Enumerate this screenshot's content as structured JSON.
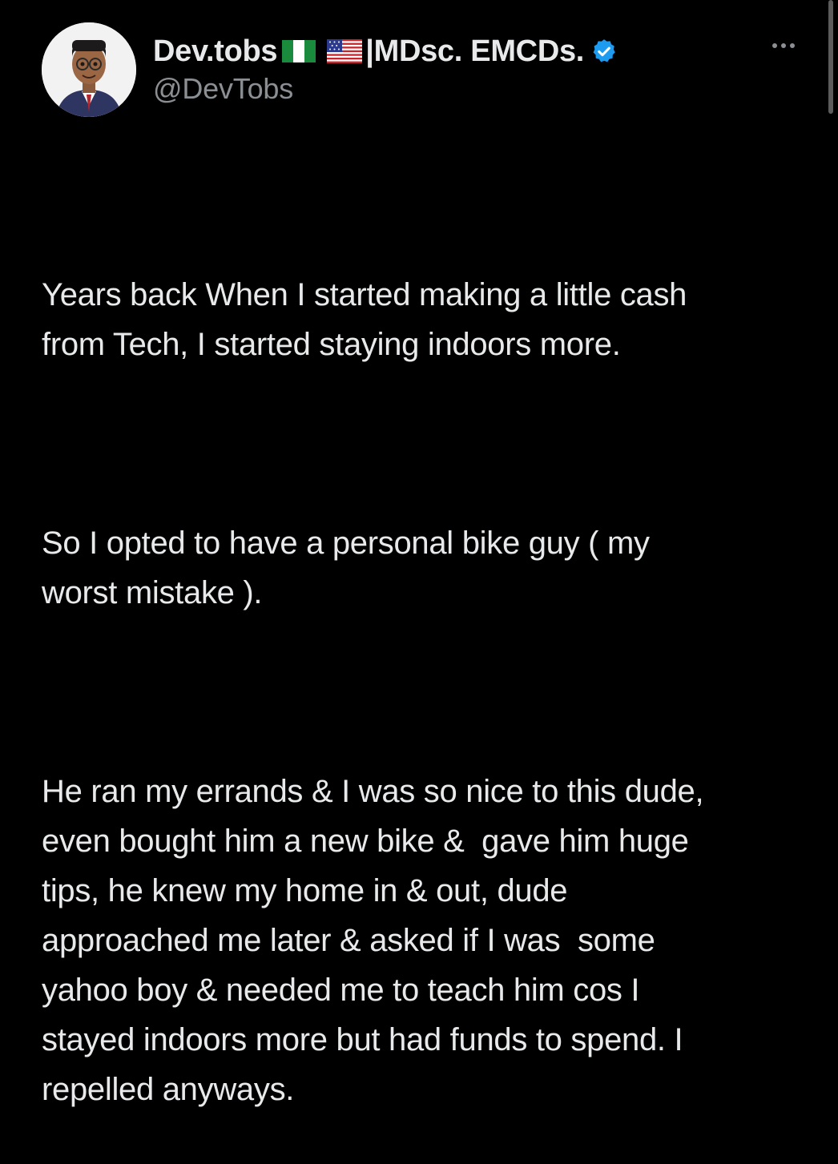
{
  "author": {
    "display_name": "Dev.tobs",
    "name_suffix": "|MDsc. EMCDs.",
    "handle": "@DevTobs",
    "verified": true
  },
  "icons": {
    "avatar": "avatar-image",
    "flags": [
      "nigeria-flag-icon",
      "usa-flag-icon"
    ],
    "verified": "verified-badge-icon",
    "more": "more-options-icon"
  },
  "colors": {
    "background": "#000000",
    "text": "#e7e9ea",
    "secondary": "#8b8f94",
    "verified": "#1d9bf0"
  },
  "tweet": {
    "paragraphs": [
      "Years back When I started making a little cash\nfrom Tech, I started staying indoors more.",
      "So I opted to have a personal bike guy ( my\nworst mistake ).",
      "He ran my errands & I was so nice to this dude,\neven bought him a new bike &  gave him huge\ntips, he knew my home in & out, dude\napproached me later & asked if I was  some\nyahoo boy & needed me to teach him cos I\nstayed indoors more but had funds to spend. I\nrepelled anyways."
    ]
  }
}
